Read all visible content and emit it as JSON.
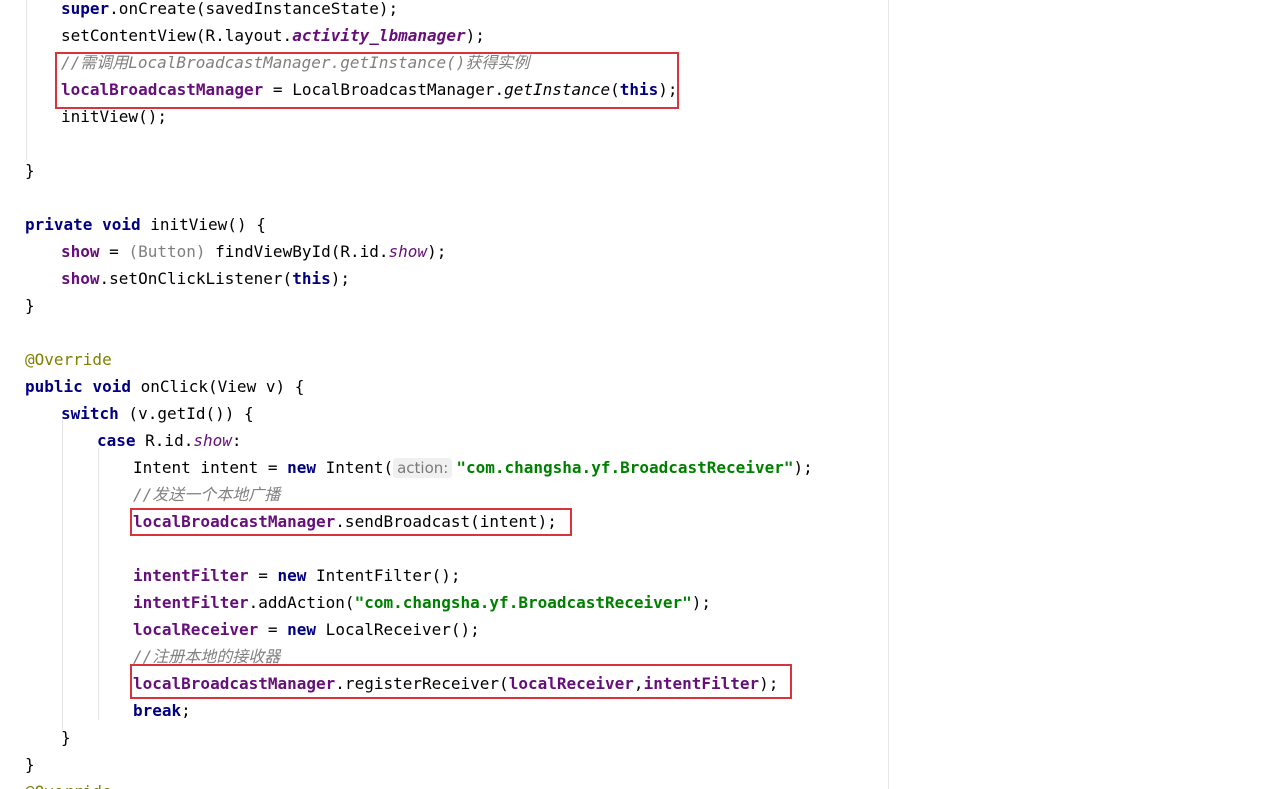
{
  "colors": {
    "keyword": "#000080",
    "field": "#660e7a",
    "string": "#008000",
    "comment": "#808080",
    "annotation": "#808000",
    "highlight_box": "#d9333b",
    "param_hint_bg": "#f0f0f0"
  },
  "code_lines": [
    {
      "indent": 1,
      "tokens": [
        {
          "t": "super",
          "c": "kw"
        },
        {
          "t": ".onCreate(savedInstanceState);"
        }
      ]
    },
    {
      "indent": 1,
      "tokens": [
        {
          "t": "setContentView(R.layout."
        },
        {
          "t": "activity_lbmanager",
          "c": "sfield"
        },
        {
          "t": ");"
        }
      ]
    },
    {
      "indent": 1,
      "tokens": [
        {
          "t": "//需调用LocalBroadcastManager.getInstance()获得实例",
          "c": "cmt"
        }
      ]
    },
    {
      "indent": 1,
      "tokens": [
        {
          "t": "localBroadcastManager",
          "c": "field"
        },
        {
          "t": " = LocalBroadcastManager."
        },
        {
          "t": "getInstance",
          "c": "smethod"
        },
        {
          "t": "("
        },
        {
          "t": "this",
          "c": "kw"
        },
        {
          "t": ");"
        }
      ]
    },
    {
      "indent": 1,
      "tokens": [
        {
          "t": "initView();"
        }
      ]
    },
    {
      "indent": 0,
      "tokens": []
    },
    {
      "indent": 0,
      "tokens": [
        {
          "t": "}"
        }
      ]
    },
    {
      "indent": 0,
      "tokens": []
    },
    {
      "indent": 0,
      "tokens": [
        {
          "t": "private",
          "c": "kw"
        },
        {
          "t": " "
        },
        {
          "t": "void",
          "c": "kw"
        },
        {
          "t": " initView() {"
        }
      ]
    },
    {
      "indent": 1,
      "tokens": [
        {
          "t": "show",
          "c": "field"
        },
        {
          "t": " = "
        },
        {
          "t": "(Button)",
          "c": "cast"
        },
        {
          "t": " findViewById(R.id."
        },
        {
          "t": "show",
          "c": "sitalic"
        },
        {
          "t": ");"
        }
      ]
    },
    {
      "indent": 1,
      "tokens": [
        {
          "t": "show",
          "c": "field"
        },
        {
          "t": ".setOnClickListener("
        },
        {
          "t": "this",
          "c": "kw"
        },
        {
          "t": ");"
        }
      ]
    },
    {
      "indent": 0,
      "tokens": [
        {
          "t": "}"
        }
      ]
    },
    {
      "indent": 0,
      "tokens": []
    },
    {
      "indent": 0,
      "tokens": [
        {
          "t": "@Override",
          "c": "ann"
        }
      ]
    },
    {
      "indent": 0,
      "tokens": [
        {
          "t": "public",
          "c": "kw"
        },
        {
          "t": " "
        },
        {
          "t": "void",
          "c": "kw"
        },
        {
          "t": " onClick(View v) {"
        }
      ]
    },
    {
      "indent": 1,
      "tokens": [
        {
          "t": "switch",
          "c": "kw"
        },
        {
          "t": " (v.getId()) {"
        }
      ]
    },
    {
      "indent": 2,
      "tokens": [
        {
          "t": "case",
          "c": "kw"
        },
        {
          "t": " R.id."
        },
        {
          "t": "show",
          "c": "sitalic"
        },
        {
          "t": ":"
        }
      ]
    },
    {
      "indent": 3,
      "tokens": [
        {
          "t": "Intent intent = "
        },
        {
          "t": "new",
          "c": "kw"
        },
        {
          "t": " Intent("
        },
        {
          "t": "action:",
          "c": "hint"
        },
        {
          "t": "\"com.changsha.yf.BroadcastReceiver\"",
          "c": "str"
        },
        {
          "t": ");"
        }
      ]
    },
    {
      "indent": 3,
      "tokens": [
        {
          "t": "//发送一个本地广播",
          "c": "cmt"
        }
      ]
    },
    {
      "indent": 3,
      "tokens": [
        {
          "t": "localBroadcastManager",
          "c": "field"
        },
        {
          "t": ".sendBroadcast(intent);"
        }
      ]
    },
    {
      "indent": 0,
      "tokens": []
    },
    {
      "indent": 3,
      "tokens": [
        {
          "t": "intentFilter",
          "c": "field"
        },
        {
          "t": " = "
        },
        {
          "t": "new",
          "c": "kw"
        },
        {
          "t": " IntentFilter();"
        }
      ]
    },
    {
      "indent": 3,
      "tokens": [
        {
          "t": "intentFilter",
          "c": "field"
        },
        {
          "t": ".addAction("
        },
        {
          "t": "\"com.changsha.yf.BroadcastReceiver\"",
          "c": "str"
        },
        {
          "t": ");"
        }
      ]
    },
    {
      "indent": 3,
      "tokens": [
        {
          "t": "localReceiver",
          "c": "field"
        },
        {
          "t": " = "
        },
        {
          "t": "new",
          "c": "kw"
        },
        {
          "t": " LocalReceiver();"
        }
      ]
    },
    {
      "indent": 3,
      "tokens": [
        {
          "t": "//注册本地的接收器",
          "c": "cmt"
        }
      ]
    },
    {
      "indent": 3,
      "tokens": [
        {
          "t": "localBroadcastManager",
          "c": "field"
        },
        {
          "t": ".registerReceiver("
        },
        {
          "t": "localReceiver",
          "c": "field"
        },
        {
          "t": ","
        },
        {
          "t": "intentFilter",
          "c": "field"
        },
        {
          "t": ");"
        }
      ]
    },
    {
      "indent": 3,
      "tokens": [
        {
          "t": "break",
          "c": "kw"
        },
        {
          "t": ";"
        }
      ]
    },
    {
      "indent": 1,
      "tokens": [
        {
          "t": "}"
        }
      ]
    },
    {
      "indent": 0,
      "tokens": [
        {
          "t": "}"
        }
      ]
    },
    {
      "indent": 0,
      "tokens": [
        {
          "t": "@Override",
          "c": "ann"
        }
      ]
    }
  ]
}
